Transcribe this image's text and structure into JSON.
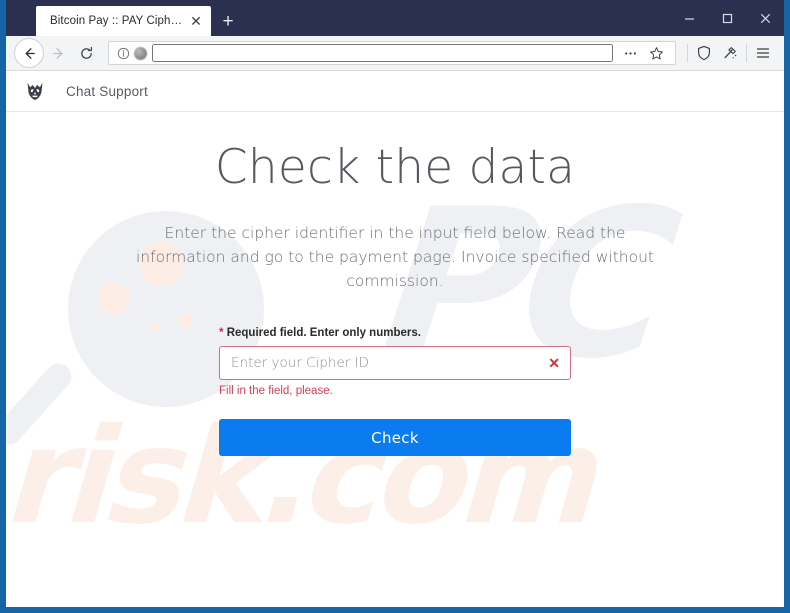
{
  "browser": {
    "tab": {
      "title": "Bitcoin Pay :: PAY CipherID",
      "close_label": "✕"
    },
    "new_tab_label": "+",
    "window_controls": {
      "minimize": "Minimize",
      "maximize": "Maximize",
      "close": "Close"
    },
    "toolbar": {
      "back": "Back",
      "forward": "Forward",
      "reload": "Reload",
      "url_value": "",
      "url_placeholder": "",
      "page_actions": "…",
      "bookmark": "Bookmark this page",
      "shield": "Tracking protection",
      "pocket": "Save to Pocket",
      "menu": "Open application menu"
    }
  },
  "site": {
    "logo_name": "demon-skull-logo",
    "nav_link": "Chat Support"
  },
  "main": {
    "headline": "Check the data",
    "subtext": "Enter the cipher identifier in the input field below. Read the information and go to the payment page. Invoice specified without commission.",
    "field_label": "Required field. Enter only numbers.",
    "required_marker": "*",
    "input_placeholder": "Enter your Cipher ID",
    "input_value": "",
    "invalid_icon": "✕",
    "error_message": "Fill in the field, please.",
    "submit_label": "Check"
  },
  "watermark": {
    "letters": "PC",
    "domain": "risk.com"
  },
  "colors": {
    "frame_blue": "#1565a6",
    "titlebar": "#2b3050",
    "accent_blue": "#0b7bf0",
    "error_red": "#d0415a",
    "input_border_red": "#d0707c",
    "headline_gray": "#55595e",
    "watermark_gray": "#eef0f3",
    "watermark_peach": "#fcefe8"
  }
}
